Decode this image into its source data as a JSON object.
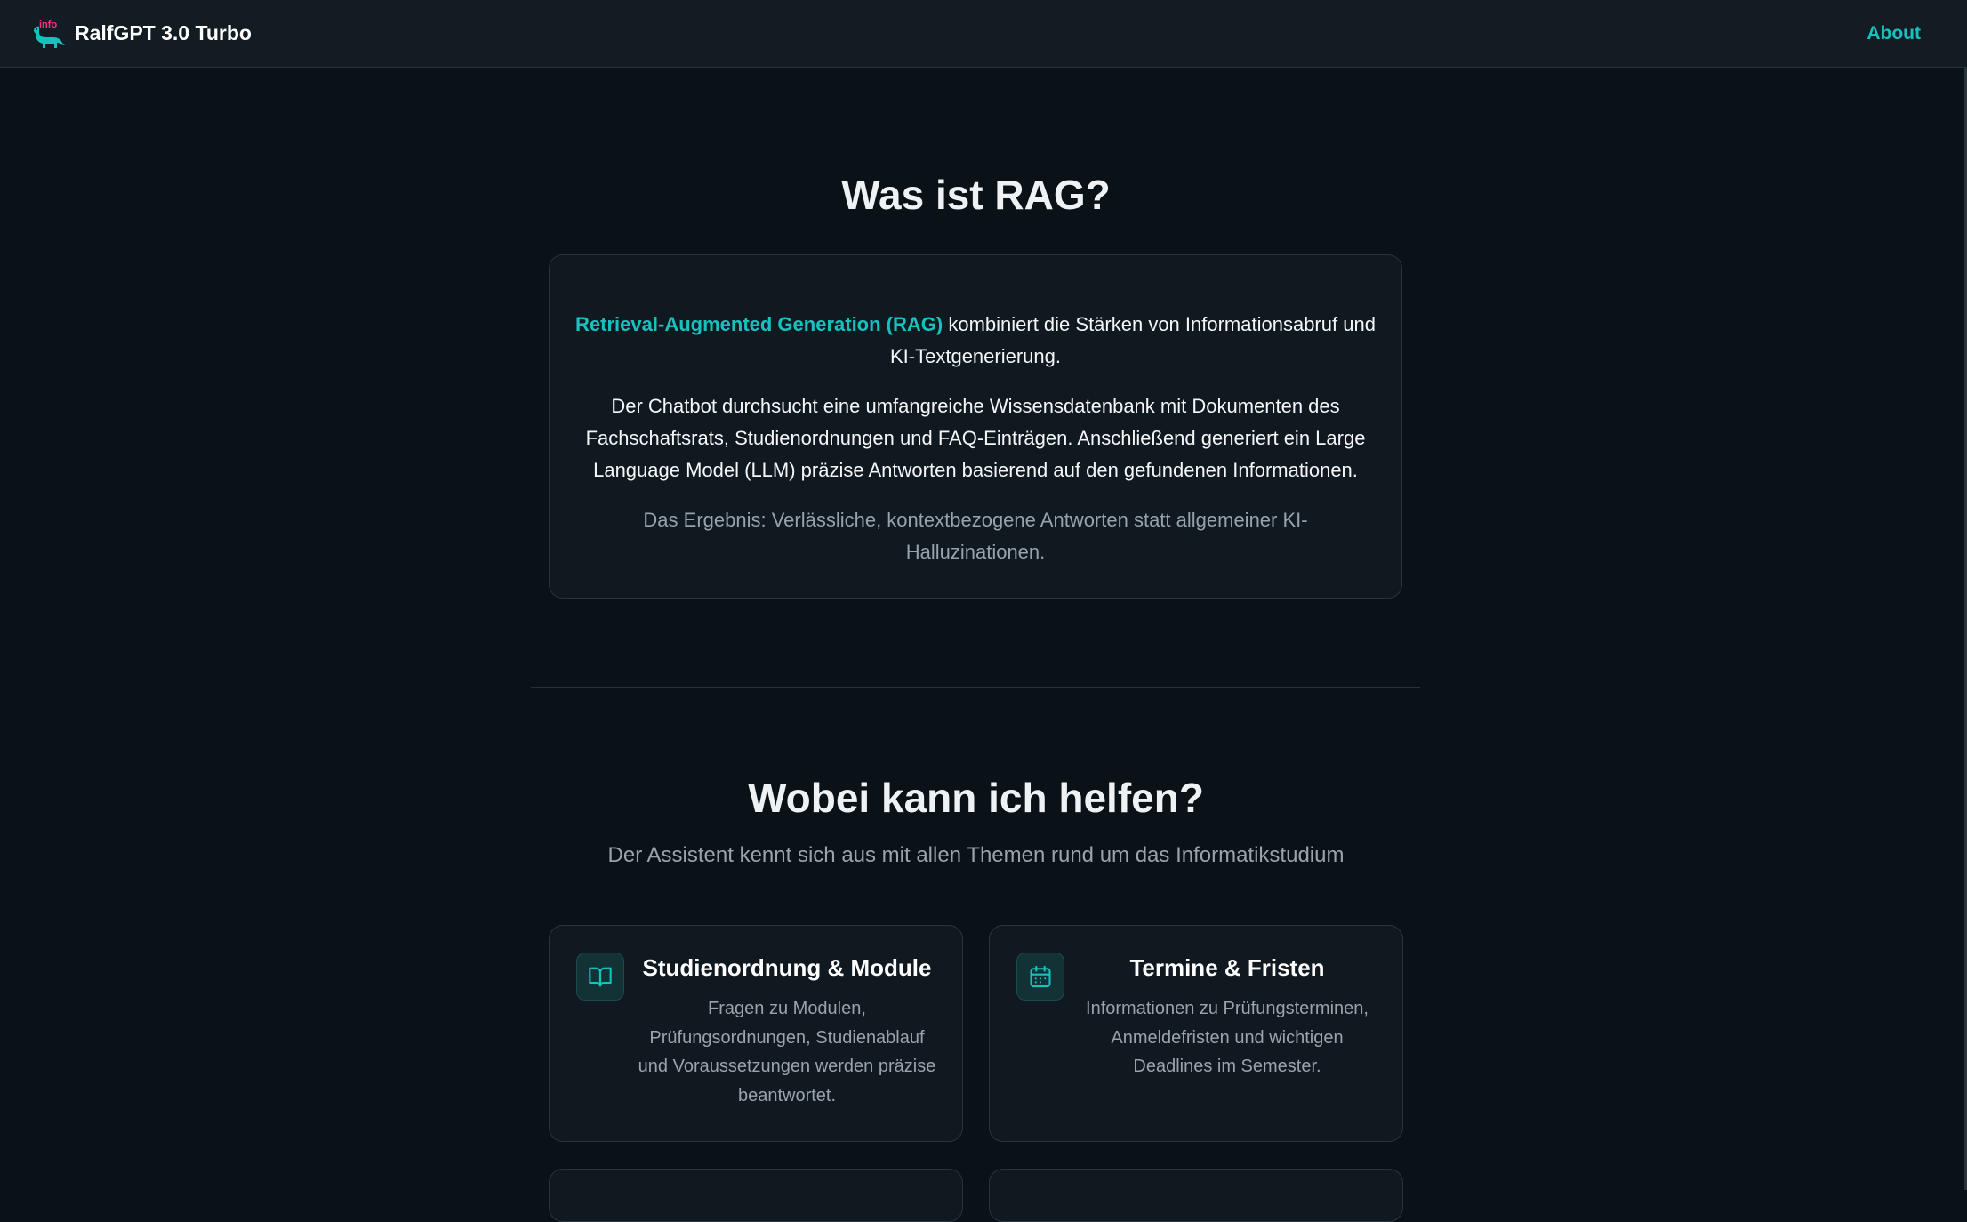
{
  "navbar": {
    "brand_name": "RalfGPT 3.0 Turbo",
    "logo_text": "info",
    "about_label": "About"
  },
  "rag": {
    "title": "Was ist RAG?",
    "highlight": "Retrieval-Augmented Generation (RAG)",
    "paragraph1_rest": " kombiniert die Stärken von Informationsabruf und KI-Textgenerierung.",
    "paragraph2": "Der Chatbot durchsucht eine umfangreiche Wissensdatenbank mit Dokumenten des Fachschaftsrats, Studienordnungen und FAQ-Einträgen. Anschließend generiert ein Large Language Model (LLM) präzise Antworten basierend auf den gefundenen Informationen.",
    "paragraph3": "Das Ergebnis: Verlässliche, kontextbezogene Antworten statt allgemeiner KI-Halluzinationen."
  },
  "help": {
    "title": "Wobei kann ich helfen?",
    "subtitle": "Der Assistent kennt sich aus mit allen Themen rund um das Informatikstudium",
    "cards": [
      {
        "icon": "book-open-icon",
        "title": "Studienordnung & Module",
        "description": "Fragen zu Modulen, Prüfungsordnungen, Studienablauf und Voraussetzungen werden präzise beantwortet."
      },
      {
        "icon": "calendar-icon",
        "title": "Termine & Fristen",
        "description": "Informationen zu Prüfungsterminen, Anmeldefristen und wichtigen Deadlines im Semester."
      }
    ]
  },
  "colors": {
    "background": "#0a1117",
    "navbar": "#131c23",
    "card": "#101820",
    "accent": "#17c2be",
    "logo_pink": "#ff2d8a",
    "muted_text": "#9aa3ab"
  }
}
